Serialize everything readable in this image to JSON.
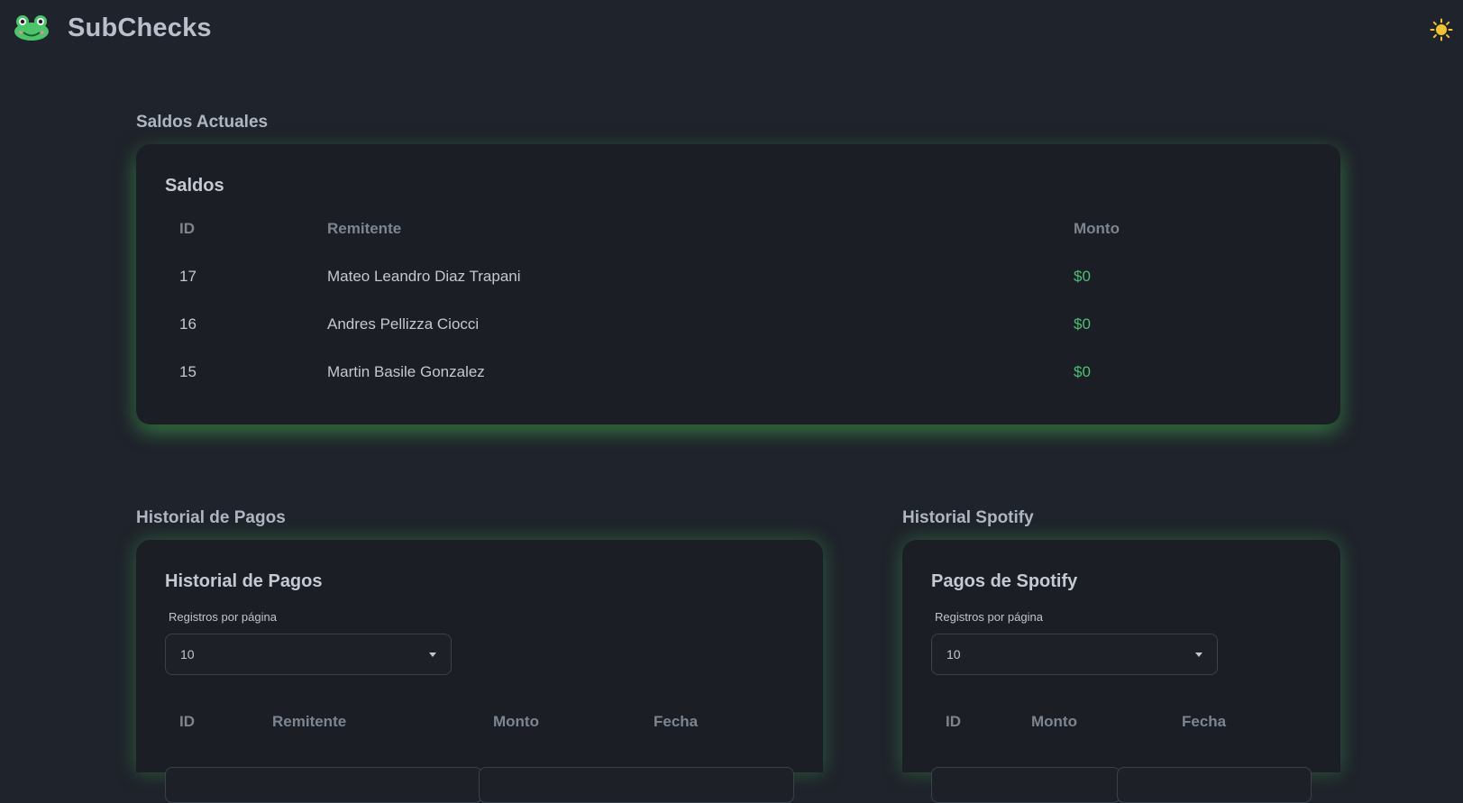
{
  "app": {
    "name": "SubChecks",
    "logo_icon": "frog-icon",
    "theme_icon": "sun-icon"
  },
  "colors": {
    "background": "#1f232b",
    "card": "#1b1e24",
    "accent_glow": "#48be5a",
    "money": "#4fbf76"
  },
  "saldos": {
    "section_title": "Saldos Actuales",
    "card_title": "Saldos",
    "columns": [
      "ID",
      "Remitente",
      "Monto"
    ],
    "rows": [
      {
        "id": "17",
        "remitente": "Mateo Leandro Diaz Trapani",
        "monto": "$0"
      },
      {
        "id": "16",
        "remitente": "Andres Pellizza Ciocci",
        "monto": "$0"
      },
      {
        "id": "15",
        "remitente": "Martin Basile Gonzalez",
        "monto": "$0"
      }
    ]
  },
  "historial_pagos": {
    "section_title": "Historial de Pagos",
    "card_title": "Historial de Pagos",
    "per_page_label": "Registros por página",
    "per_page_value": "10",
    "columns": [
      "ID",
      "Remitente",
      "Monto",
      "Fecha"
    ]
  },
  "historial_spotify": {
    "section_title": "Historial Spotify",
    "card_title": "Pagos de Spotify",
    "per_page_label": "Registros por página",
    "per_page_value": "10",
    "columns": [
      "ID",
      "Monto",
      "Fecha"
    ]
  }
}
